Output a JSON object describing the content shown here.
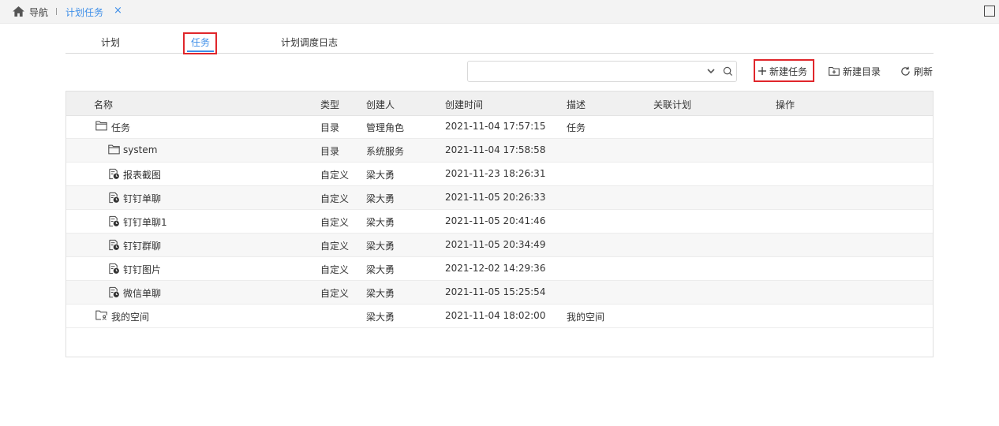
{
  "topbar": {
    "nav_label": "导航",
    "active_tab_label": "计划任务",
    "close_glyph": "×"
  },
  "subtabs": [
    {
      "label": "计划",
      "active": false
    },
    {
      "label": "任务",
      "active": true
    },
    {
      "label": "计划调度日志",
      "active": false
    }
  ],
  "toolbar": {
    "search_value": "",
    "search_placeholder": "",
    "new_task_label": "新建任务",
    "new_folder_label": "新建目录",
    "refresh_label": "刷新"
  },
  "colors": {
    "accent": "#3d8ee8",
    "highlight_box": "#e0262b",
    "header_bg": "#f0f0f0"
  },
  "table": {
    "columns": [
      "名称",
      "类型",
      "创建人",
      "创建时间",
      "描述",
      "关联计划",
      "操作"
    ],
    "rows": [
      {
        "icon": "folder-icon",
        "name": "任务",
        "type": "目录",
        "creator": "管理角色",
        "created": "2021-11-04 17:57:15",
        "desc": "任务",
        "plan": "",
        "level": 1
      },
      {
        "icon": "folder-icon",
        "name": "system",
        "type": "目录",
        "creator": "系统服务",
        "created": "2021-11-04 17:58:58",
        "desc": "",
        "plan": "",
        "level": 2
      },
      {
        "icon": "task-icon",
        "name": "报表截图",
        "type": "自定义",
        "creator": "梁大勇",
        "created": "2021-11-23 18:26:31",
        "desc": "",
        "plan": "",
        "level": 2
      },
      {
        "icon": "task-icon",
        "name": "钉钉单聊",
        "type": "自定义",
        "creator": "梁大勇",
        "created": "2021-11-05 20:26:33",
        "desc": "",
        "plan": "",
        "level": 2
      },
      {
        "icon": "task-icon",
        "name": "钉钉单聊1",
        "type": "自定义",
        "creator": "梁大勇",
        "created": "2021-11-05 20:41:46",
        "desc": "",
        "plan": "",
        "level": 2
      },
      {
        "icon": "task-icon",
        "name": "钉钉群聊",
        "type": "自定义",
        "creator": "梁大勇",
        "created": "2021-11-05 20:34:49",
        "desc": "",
        "plan": "",
        "level": 2
      },
      {
        "icon": "task-icon",
        "name": "钉钉图片",
        "type": "自定义",
        "creator": "梁大勇",
        "created": "2021-12-02 14:29:36",
        "desc": "",
        "plan": "",
        "level": 2
      },
      {
        "icon": "task-icon",
        "name": "微信单聊",
        "type": "自定义",
        "creator": "梁大勇",
        "created": "2021-11-05 15:25:54",
        "desc": "",
        "plan": "",
        "level": 2
      },
      {
        "icon": "user-folder-icon",
        "name": "我的空间",
        "type": "",
        "creator": "梁大勇",
        "created": "2021-11-04 18:02:00",
        "desc": "我的空间",
        "plan": "",
        "level": 1
      }
    ]
  }
}
